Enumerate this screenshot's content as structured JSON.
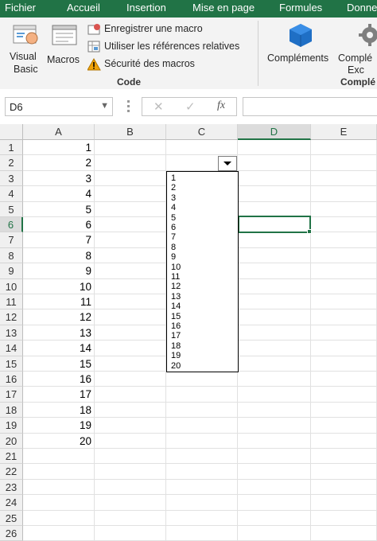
{
  "menu": [
    "Fichier",
    "Accueil",
    "Insertion",
    "Mise en page",
    "Formules",
    "Donne"
  ],
  "ribbon": {
    "visual_basic_line1": "Visual",
    "visual_basic_line2": "Basic",
    "macros": "Macros",
    "record_macro": "Enregistrer une macro",
    "relative_refs": "Utiliser les références relatives",
    "macro_security": "Sécurité des macros",
    "code_group": "Code",
    "complements": "Compléments",
    "complements_cut_line1": "Complé",
    "complements_cut_line2": "Exc",
    "complements_group_cut": "Complé"
  },
  "namebox": {
    "value": "D6"
  },
  "formula": {
    "fx": "fx"
  },
  "grid": {
    "columns": [
      "A",
      "B",
      "C",
      "D",
      "E"
    ],
    "active_column": "D",
    "rows": [
      "1",
      "2",
      "3",
      "4",
      "5",
      "6",
      "7",
      "8",
      "9",
      "10",
      "11",
      "12",
      "13",
      "14",
      "15",
      "16",
      "17",
      "18",
      "19",
      "20",
      "21",
      "22",
      "23",
      "24",
      "25",
      "26"
    ],
    "active_row": "6",
    "col_a_values": [
      "1",
      "2",
      "3",
      "4",
      "5",
      "6",
      "7",
      "8",
      "9",
      "10",
      "11",
      "12",
      "13",
      "14",
      "15",
      "16",
      "17",
      "18",
      "19",
      "20"
    ]
  },
  "dropdown": {
    "items": [
      "1",
      "2",
      "3",
      "4",
      "5",
      "6",
      "7",
      "8",
      "9",
      "10",
      "11",
      "12",
      "13",
      "14",
      "15",
      "16",
      "17",
      "18",
      "19",
      "20"
    ]
  },
  "colors": {
    "accent": "#217346",
    "menubar": "#217346"
  }
}
